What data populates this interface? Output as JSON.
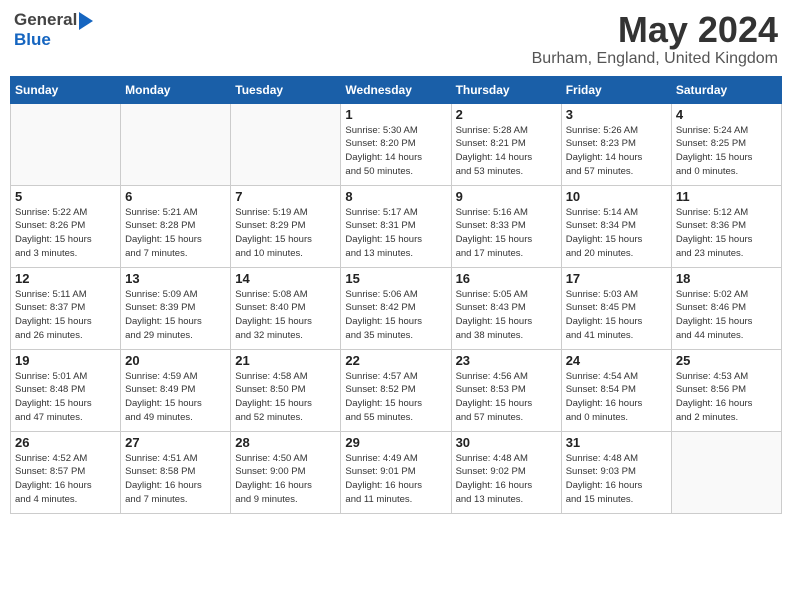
{
  "header": {
    "logo_general": "General",
    "logo_blue": "Blue",
    "month_title": "May 2024",
    "location": "Burham, England, United Kingdom"
  },
  "weekdays": [
    "Sunday",
    "Monday",
    "Tuesday",
    "Wednesday",
    "Thursday",
    "Friday",
    "Saturday"
  ],
  "weeks": [
    [
      {
        "day": "",
        "info": ""
      },
      {
        "day": "",
        "info": ""
      },
      {
        "day": "",
        "info": ""
      },
      {
        "day": "1",
        "info": "Sunrise: 5:30 AM\nSunset: 8:20 PM\nDaylight: 14 hours\nand 50 minutes."
      },
      {
        "day": "2",
        "info": "Sunrise: 5:28 AM\nSunset: 8:21 PM\nDaylight: 14 hours\nand 53 minutes."
      },
      {
        "day": "3",
        "info": "Sunrise: 5:26 AM\nSunset: 8:23 PM\nDaylight: 14 hours\nand 57 minutes."
      },
      {
        "day": "4",
        "info": "Sunrise: 5:24 AM\nSunset: 8:25 PM\nDaylight: 15 hours\nand 0 minutes."
      }
    ],
    [
      {
        "day": "5",
        "info": "Sunrise: 5:22 AM\nSunset: 8:26 PM\nDaylight: 15 hours\nand 3 minutes."
      },
      {
        "day": "6",
        "info": "Sunrise: 5:21 AM\nSunset: 8:28 PM\nDaylight: 15 hours\nand 7 minutes."
      },
      {
        "day": "7",
        "info": "Sunrise: 5:19 AM\nSunset: 8:29 PM\nDaylight: 15 hours\nand 10 minutes."
      },
      {
        "day": "8",
        "info": "Sunrise: 5:17 AM\nSunset: 8:31 PM\nDaylight: 15 hours\nand 13 minutes."
      },
      {
        "day": "9",
        "info": "Sunrise: 5:16 AM\nSunset: 8:33 PM\nDaylight: 15 hours\nand 17 minutes."
      },
      {
        "day": "10",
        "info": "Sunrise: 5:14 AM\nSunset: 8:34 PM\nDaylight: 15 hours\nand 20 minutes."
      },
      {
        "day": "11",
        "info": "Sunrise: 5:12 AM\nSunset: 8:36 PM\nDaylight: 15 hours\nand 23 minutes."
      }
    ],
    [
      {
        "day": "12",
        "info": "Sunrise: 5:11 AM\nSunset: 8:37 PM\nDaylight: 15 hours\nand 26 minutes."
      },
      {
        "day": "13",
        "info": "Sunrise: 5:09 AM\nSunset: 8:39 PM\nDaylight: 15 hours\nand 29 minutes."
      },
      {
        "day": "14",
        "info": "Sunrise: 5:08 AM\nSunset: 8:40 PM\nDaylight: 15 hours\nand 32 minutes."
      },
      {
        "day": "15",
        "info": "Sunrise: 5:06 AM\nSunset: 8:42 PM\nDaylight: 15 hours\nand 35 minutes."
      },
      {
        "day": "16",
        "info": "Sunrise: 5:05 AM\nSunset: 8:43 PM\nDaylight: 15 hours\nand 38 minutes."
      },
      {
        "day": "17",
        "info": "Sunrise: 5:03 AM\nSunset: 8:45 PM\nDaylight: 15 hours\nand 41 minutes."
      },
      {
        "day": "18",
        "info": "Sunrise: 5:02 AM\nSunset: 8:46 PM\nDaylight: 15 hours\nand 44 minutes."
      }
    ],
    [
      {
        "day": "19",
        "info": "Sunrise: 5:01 AM\nSunset: 8:48 PM\nDaylight: 15 hours\nand 47 minutes."
      },
      {
        "day": "20",
        "info": "Sunrise: 4:59 AM\nSunset: 8:49 PM\nDaylight: 15 hours\nand 49 minutes."
      },
      {
        "day": "21",
        "info": "Sunrise: 4:58 AM\nSunset: 8:50 PM\nDaylight: 15 hours\nand 52 minutes."
      },
      {
        "day": "22",
        "info": "Sunrise: 4:57 AM\nSunset: 8:52 PM\nDaylight: 15 hours\nand 55 minutes."
      },
      {
        "day": "23",
        "info": "Sunrise: 4:56 AM\nSunset: 8:53 PM\nDaylight: 15 hours\nand 57 minutes."
      },
      {
        "day": "24",
        "info": "Sunrise: 4:54 AM\nSunset: 8:54 PM\nDaylight: 16 hours\nand 0 minutes."
      },
      {
        "day": "25",
        "info": "Sunrise: 4:53 AM\nSunset: 8:56 PM\nDaylight: 16 hours\nand 2 minutes."
      }
    ],
    [
      {
        "day": "26",
        "info": "Sunrise: 4:52 AM\nSunset: 8:57 PM\nDaylight: 16 hours\nand 4 minutes."
      },
      {
        "day": "27",
        "info": "Sunrise: 4:51 AM\nSunset: 8:58 PM\nDaylight: 16 hours\nand 7 minutes."
      },
      {
        "day": "28",
        "info": "Sunrise: 4:50 AM\nSunset: 9:00 PM\nDaylight: 16 hours\nand 9 minutes."
      },
      {
        "day": "29",
        "info": "Sunrise: 4:49 AM\nSunset: 9:01 PM\nDaylight: 16 hours\nand 11 minutes."
      },
      {
        "day": "30",
        "info": "Sunrise: 4:48 AM\nSunset: 9:02 PM\nDaylight: 16 hours\nand 13 minutes."
      },
      {
        "day": "31",
        "info": "Sunrise: 4:48 AM\nSunset: 9:03 PM\nDaylight: 16 hours\nand 15 minutes."
      },
      {
        "day": "",
        "info": ""
      }
    ]
  ]
}
